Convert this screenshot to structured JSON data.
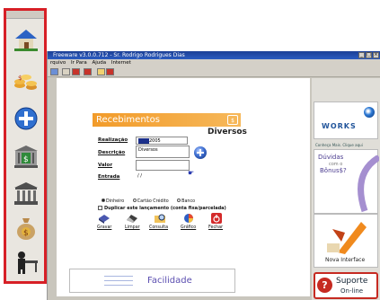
{
  "window": {
    "title": "Freeware v3.0.0.712 - Sr. Rodrigo Rodrigues Dias",
    "btn_min": "_",
    "btn_max": "□",
    "btn_close": "×"
  },
  "menu": {
    "items": [
      "Arquivo",
      "Ir Para",
      "Ajuda",
      "Internet"
    ],
    "arquivo_visible": "rquivo"
  },
  "dialog": {
    "title": "Recebimentos",
    "badge": "$",
    "category": "Diversos",
    "fields": {
      "realizacao_label": "Realização",
      "realizacao_value": "2005",
      "descricao_label": "Descrição",
      "descricao_value": "Diversos",
      "valor_label": "Valor",
      "entrada_label": "Entrada",
      "entrada_value": "/ /"
    },
    "payment_options": [
      "Dinheiro",
      "Cartão Crédito",
      "Banco"
    ],
    "selected_payment": "Dinheiro",
    "duplicate_label": "Duplicar este lançamento (conta fixa/parcelada)",
    "buttons": [
      "Gravar",
      "Limpar",
      "Consulta",
      "Gráfico",
      "Fechar"
    ]
  },
  "right_ads": {
    "works": "WORKS",
    "caption": "Conheça Mais. Clique aqui",
    "bonus_title": "Dúvidas",
    "bonus_mid": "com o",
    "bonus_name": "Bônus$?",
    "nova_label": "Nova Interface",
    "suporte_line1": "Suporte",
    "suporte_line2": "On-line",
    "suporte_icon": "?"
  },
  "banner": {
    "text": "Facilidade"
  },
  "left_toolbar": {
    "icons": [
      "house-icon",
      "coins-icon",
      "plus-icon",
      "bank-dollar-icon",
      "bank-icon",
      "money-bag-icon",
      "person-desk-icon"
    ]
  },
  "colors": {
    "toolbar_border": "#d71f26",
    "dialog_header": "#f29b2a",
    "titlebar": "#1b3f95",
    "banner_text": "#5b4eb0"
  }
}
